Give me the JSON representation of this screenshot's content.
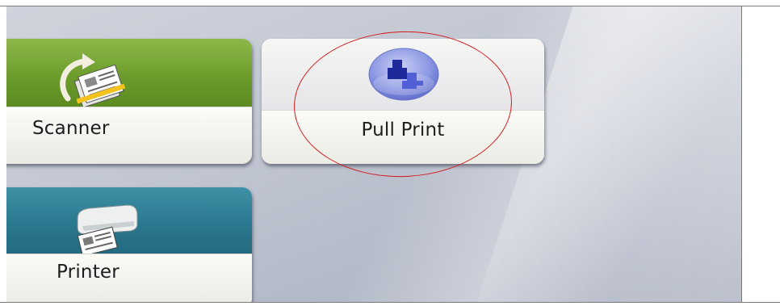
{
  "tiles": {
    "scanner": {
      "label": "Scanner",
      "icon": "scanner-icon",
      "color": "#6a9a2a"
    },
    "pull_print": {
      "label": "Pull Print",
      "icon": "pull-print-icon",
      "color": "#3a47c4"
    },
    "printer": {
      "label": "Printer",
      "icon": "printer-icon",
      "color": "#2a7890"
    }
  },
  "annotation": {
    "highlight_color": "#d21e1e"
  }
}
